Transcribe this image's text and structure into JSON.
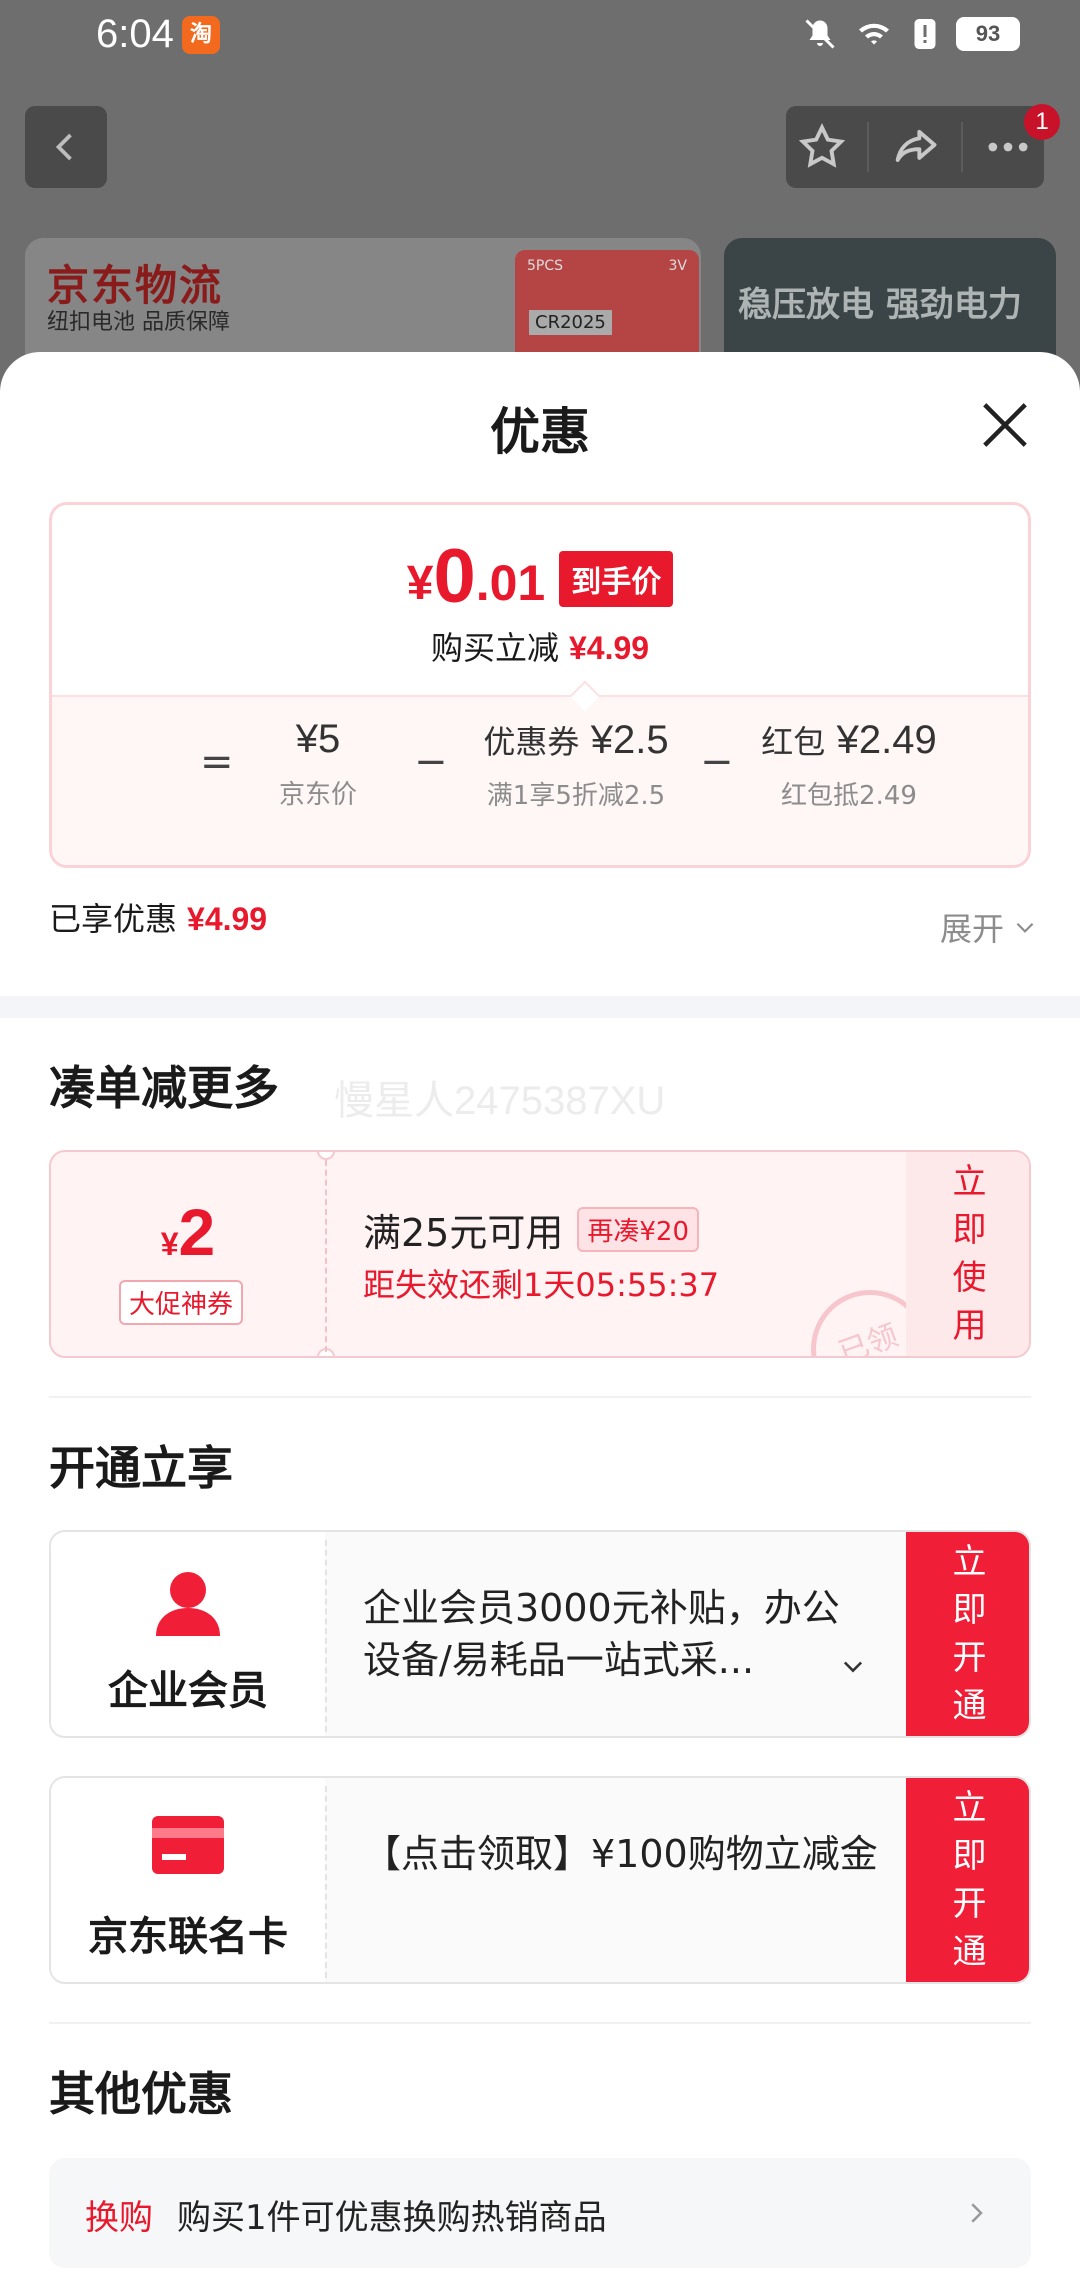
{
  "status_bar": {
    "time": "6:04",
    "app_icon_text": "淘",
    "battery": "93"
  },
  "background": {
    "brand": "京东物流",
    "brand_sub": "纽扣电池 品质保障",
    "pack_count": "5PCS",
    "pack_volt": "3V",
    "pack_model": "CR2025",
    "right_banner": "稳压放电 强劲电力",
    "message_badge": "1"
  },
  "sheet": {
    "title": "优惠",
    "price": {
      "currency": "¥",
      "integer": "0",
      "decimal": ".01",
      "tag": "到手价"
    },
    "reduce": {
      "label": "购买立减",
      "value": "¥4.99"
    },
    "calc": {
      "eq": "=",
      "minus": "−",
      "terms": [
        {
          "label": "",
          "amount": "¥5",
          "caption": "京东价"
        },
        {
          "label": "优惠券",
          "amount": "¥2.5",
          "caption": "满1享5折减2.5"
        },
        {
          "label": "红包",
          "amount": "¥2.49",
          "caption": "红包抵2.49"
        }
      ]
    },
    "enjoyed": {
      "label": "已享优惠",
      "value": "¥4.99"
    },
    "expand_label": "展开"
  },
  "more_section": {
    "title": "凑单减更多",
    "watermark": "慢星人2475387XU",
    "coupon": {
      "currency": "¥",
      "amount": "2",
      "tag": "大促神券",
      "condition": "满25元可用",
      "badge": "再凑¥20",
      "expire": "距失效还剩1天05:55:37",
      "action": "立即使用",
      "stamp": "已领"
    }
  },
  "open_section": {
    "title": "开通立享",
    "cards": [
      {
        "name": "企业会员",
        "desc": "企业会员3000元补贴，办公设备/易耗品一站式采...",
        "action": "立即开通"
      },
      {
        "name": "京东联名卡",
        "desc": "【点击领取】¥100购物立减金",
        "action": "立即开通"
      }
    ]
  },
  "other_section": {
    "title": "其他优惠",
    "row": {
      "tag": "换购",
      "text": "购买1件可优惠换购热销商品"
    }
  },
  "colors": {
    "accent": "#e8192c",
    "open_button": "#f01e36"
  }
}
